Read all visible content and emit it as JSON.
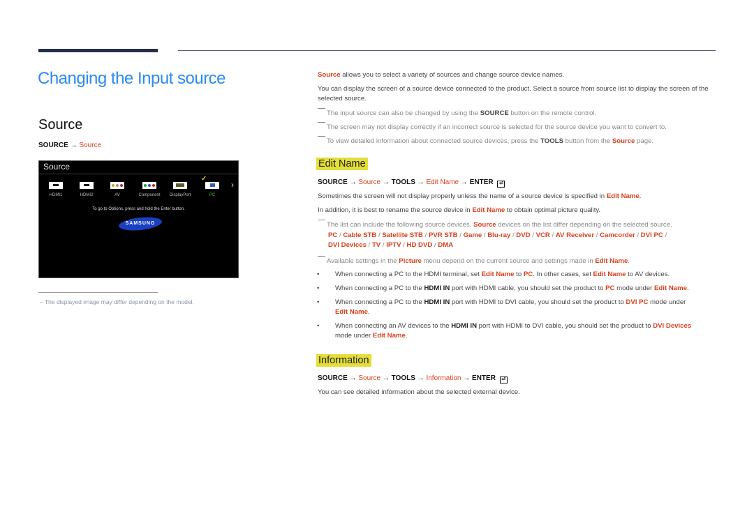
{
  "header": {
    "page_title": "Changing the Input source",
    "section_title": "Source"
  },
  "left": {
    "path": {
      "root": "SOURCE",
      "arrow": "→",
      "target": "Source"
    },
    "tv_screen": {
      "title": "Source",
      "sources": [
        {
          "label": "HDMI1",
          "icon": "hdmi-port-icon",
          "selected": false
        },
        {
          "label": "HDMI2",
          "icon": "hdmi-port-icon",
          "selected": false
        },
        {
          "label": "AV",
          "icon": "av-port-icon",
          "selected": false
        },
        {
          "label": "Component",
          "icon": "component-port-icon",
          "selected": false
        },
        {
          "label": "DisplayPort",
          "icon": "displayport-icon",
          "selected": false
        },
        {
          "label": "PC",
          "icon": "vga-port-icon",
          "selected": true
        }
      ],
      "check_icon": "✓",
      "next_icon": "›",
      "hint": "To go to Options, press and hold the Enter button.",
      "logo": "SAMSUNG"
    },
    "footnote": "The displayed image may differ depending on the model."
  },
  "right": {
    "intro": {
      "p1_highlight": "Source",
      "p1_rest": " allows you to select a variety of sources and change source device names.",
      "p2": "You can display the screen of a source device connected to the product. Select a source from source list to display the screen of the selected source."
    },
    "notes": [
      {
        "pre": "The input source can also be changed by using the ",
        "bold": "SOURCE",
        "post": " button on the remote control."
      },
      {
        "text": "The screen may not display correctly if an incorrect source is selected for the source device you want to convert to."
      },
      {
        "pre": "To view detailed information about connected source devices, press the ",
        "bold": "TOOLS",
        "mid": " button from the ",
        "red": "Source",
        "post": " page."
      }
    ],
    "edit_name": {
      "heading": "Edit Name",
      "path": {
        "p1": "SOURCE",
        "p2": "Source",
        "p3": "TOOLS",
        "p4": "Edit Name",
        "p5": "ENTER",
        "arrow": "→",
        "enter_icon": "⏎"
      },
      "s1_pre": "Sometimes the screen will not display properly unless the name of a source device is specified in ",
      "s1_red": "Edit Name",
      "s1_post": ".",
      "s2_pre": "In addition, it is best to rename the source device in ",
      "s2_red": "Edit Name",
      "s2_post": " to obtain optimal picture quality.",
      "list_note_pre": "The list can include the following source devices. ",
      "list_note_red": "Source",
      "list_note_post": " devices on the list differ depending on the selected source.",
      "devices": [
        "PC",
        "Cable STB",
        "Satellite STB",
        "PVR STB",
        "Game",
        "Blu-ray",
        "DVD",
        "VCR",
        "AV Receiver",
        "Camcorder",
        "DVI PC",
        "DVI Devices",
        "TV",
        "IPTV",
        "HD DVD",
        "DMA"
      ],
      "separator": " / ",
      "picture_note": {
        "pre": "Available settings in the ",
        "red": "Picture",
        "mid": " menu depend on the current source and settings made in ",
        "red2": "Edit Name",
        "post": "."
      },
      "bullet_char": "•",
      "bullets": [
        {
          "a": "When connecting a PC to the HDMI terminal, set ",
          "r1": "Edit Name",
          "b": " to ",
          "r2": "PC",
          "c": ". In other cases, set ",
          "r3": "Edit Name",
          "d": " to AV devices."
        },
        {
          "a": "When connecting a PC to the ",
          "bold": "HDMI IN",
          "b": " port with HDMI cable, you should set the product to ",
          "r1": "PC",
          "c": " mode under ",
          "r2": "Edit Name",
          "d": "."
        },
        {
          "a": "When connecting a PC to the ",
          "bold": "HDMI IN",
          "b": " port with HDMI to DVI cable, you should set the product to ",
          "r1": "DVI PC",
          "c": " mode under ",
          "r2": "Edit Name",
          "d": "."
        },
        {
          "a": "When connecting an AV devices to the ",
          "bold": "HDMI IN",
          "b": " port with HDMI to DVI cable, you should set the product to ",
          "r1": "DVI Devices",
          "c": " mode under ",
          "r2": "Edit Name",
          "d": "."
        }
      ]
    },
    "information": {
      "heading": "Information",
      "path": {
        "p1": "SOURCE",
        "p2": "Source",
        "p3": "TOOLS",
        "p4": "Information",
        "p5": "ENTER",
        "arrow": "→",
        "enter_icon": "⏎"
      },
      "text": "You can see detailed information about the selected external device."
    }
  },
  "colors": {
    "title_blue": "#2a8af5",
    "accent_red": "#d9401e",
    "heading_highlight": "#e3de38",
    "rule_dark": "#262e47"
  }
}
